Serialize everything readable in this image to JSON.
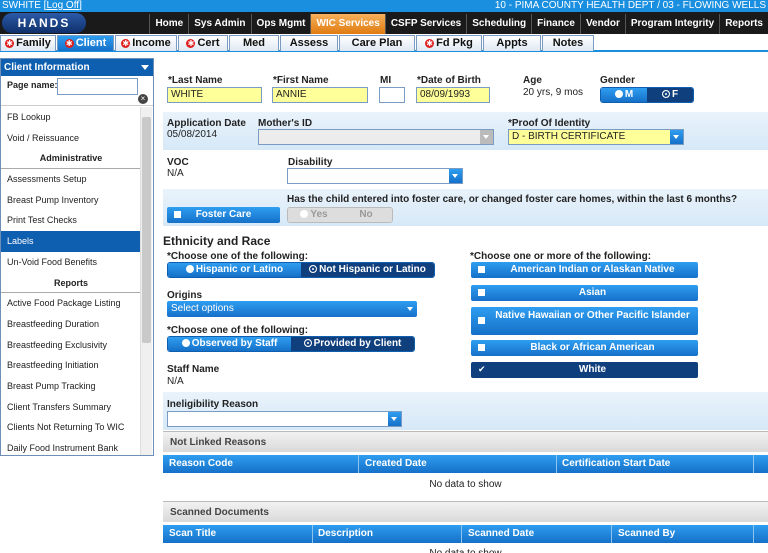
{
  "topbar": {
    "user": "SWHITE",
    "logoff": "Log Off",
    "dept": "10 - PIMA COUNTY HEALTH DEPT / 03 - FLOWING WELLS"
  },
  "logo": "HANDS",
  "mainnav": [
    "Home",
    "Sys Admin",
    "Ops Mgmt",
    "WIC Services",
    "CSFP Services",
    "Scheduling",
    "Finance",
    "Vendor",
    "Program Integrity",
    "Reports"
  ],
  "mainnav_active": "WIC Services",
  "tabs": [
    {
      "label": "Family",
      "alert": true
    },
    {
      "label": "Client",
      "alert": true,
      "active": true
    },
    {
      "label": "Income",
      "alert": true
    },
    {
      "label": "Cert",
      "alert": true
    },
    {
      "label": "Med",
      "alert": false
    },
    {
      "label": "Assess",
      "alert": false
    },
    {
      "label": "Care Plan",
      "alert": false
    },
    {
      "label": "Fd Pkg",
      "alert": true
    },
    {
      "label": "Appts",
      "alert": false
    },
    {
      "label": "Notes",
      "alert": false
    }
  ],
  "sidebar": {
    "title": "Client Information",
    "search_label": "Page name:",
    "items": [
      {
        "label": "FB Lookup",
        "type": "item"
      },
      {
        "label": "Void / Reissuance",
        "type": "item"
      },
      {
        "label": "Administrative",
        "type": "section"
      },
      {
        "label": "Assessments Setup",
        "type": "item"
      },
      {
        "label": "Breast Pump Inventory",
        "type": "item"
      },
      {
        "label": "Print Test Checks",
        "type": "item"
      },
      {
        "label": "Labels",
        "type": "item",
        "active": true
      },
      {
        "label": "Un-Void Food Benefits",
        "type": "item"
      },
      {
        "label": "Reports",
        "type": "section"
      },
      {
        "label": "Active Food Package Listing",
        "type": "item"
      },
      {
        "label": "Breastfeeding Duration",
        "type": "item"
      },
      {
        "label": "Breastfeeding Exclusivity",
        "type": "item"
      },
      {
        "label": "Breastfeeding Initiation",
        "type": "item"
      },
      {
        "label": "Breast Pump Tracking",
        "type": "item"
      },
      {
        "label": "Client Transfers Summary",
        "type": "item"
      },
      {
        "label": "Clients Not Returning To WIC",
        "type": "item"
      },
      {
        "label": "Daily Food Instrument Bank",
        "type": "item"
      }
    ]
  },
  "client": {
    "last_name_label": "*Last Name",
    "last_name": "WHITE",
    "first_name_label": "*First Name",
    "first_name": "ANNIE",
    "mi_label": "MI",
    "mi": "",
    "dob_label": "*Date of Birth",
    "dob": "08/09/1993",
    "age_label": "Age",
    "age": "20 yrs, 9 mos",
    "gender_label": "Gender",
    "gender_m": "M",
    "gender_f": "F",
    "app_date_label": "Application Date",
    "app_date": "05/08/2014",
    "mothers_id_label": "Mother's ID",
    "proof_label": "*Proof Of Identity",
    "proof": "D - BIRTH CERTIFICATE",
    "voc_label": "VOC",
    "voc": "N/A",
    "disability_label": "Disability",
    "foster_care": "Foster Care",
    "foster_question": "Has the child entered into foster care, or changed foster care homes, within the last 6 months?",
    "foster_yes": "Yes",
    "foster_no": "No"
  },
  "ethnicity": {
    "title": "Ethnicity and Race",
    "choose_one": "*Choose one of the following:",
    "hispanic": "Hispanic or Latino",
    "not_hispanic": "Not Hispanic or Latino",
    "origins_label": "Origins",
    "origins_placeholder": "Select options",
    "choose_one2": "*Choose one of the following:",
    "observed": "Observed by Staff",
    "provided": "Provided by Client",
    "staff_name_label": "Staff Name",
    "staff_name": "N/A",
    "choose_more": "*Choose one or more of the following:",
    "races": [
      {
        "label": "American Indian or Alaskan Native",
        "checked": false
      },
      {
        "label": "Asian",
        "checked": false
      },
      {
        "label": "Native Hawaiian or Other Pacific Islander",
        "checked": false
      },
      {
        "label": "Black or African American",
        "checked": false
      },
      {
        "label": "White",
        "checked": true
      }
    ]
  },
  "ineligibility_label": "Ineligibility Reason",
  "not_linked": {
    "title": "Not Linked Reasons",
    "columns": [
      "Reason Code",
      "Created Date",
      "Certification Start Date"
    ],
    "empty": "No data to show"
  },
  "scanned": {
    "title": "Scanned Documents",
    "columns": [
      "Scan Title",
      "Description",
      "Scanned Date",
      "Scanned By"
    ],
    "empty": "No data to show"
  }
}
